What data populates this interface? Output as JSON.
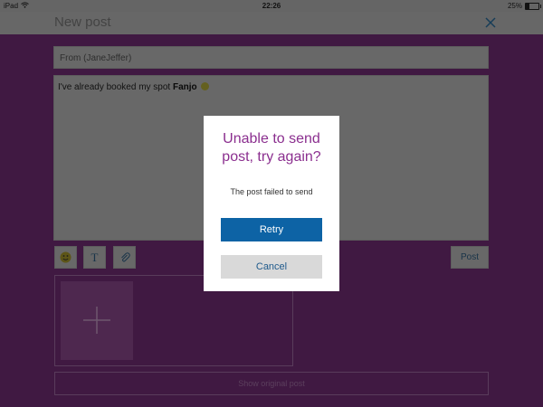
{
  "status_bar": {
    "device": "iPad",
    "time": "22:26",
    "battery_text": "25%",
    "battery_level": 0.25
  },
  "header": {
    "title": "New post",
    "close_icon": "close-icon"
  },
  "compose": {
    "from_placeholder": "From (JaneJeffer)",
    "message_prefix": "I've already booked my spot ",
    "message_bold": "Fanjo",
    "message_emoji_icon": "smiley-icon"
  },
  "toolbar": {
    "emoji_icon": "smiley-icon",
    "text_icon": "text-format-icon",
    "text_glyph": "T",
    "attach_icon": "paperclip-icon",
    "post_label": "Post"
  },
  "attachments": {
    "add_icon": "plus-icon"
  },
  "show_original_label": "Show original post",
  "dialog": {
    "title": "Unable to send post, try again?",
    "message": "The post failed to send",
    "retry_label": "Retry",
    "cancel_label": "Cancel"
  },
  "colors": {
    "background_purple": "#752e78",
    "dialog_title": "#8b2f8f",
    "retry_button": "#0d63a5",
    "cancel_button": "#d9d9d9"
  }
}
